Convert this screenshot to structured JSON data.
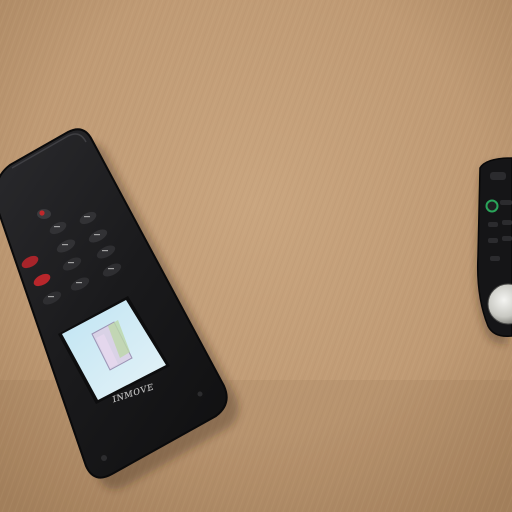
{
  "scene": {
    "surface": "tan-carpet",
    "colors": {
      "carpet": "#c49f7a",
      "carpet_dark": "#a88463",
      "remote_body": "#1c1c1e",
      "remote_edge": "#0c0c0d",
      "screen_glow": "#cfe8f2",
      "button_red": "#c0282b",
      "button_green": "#2aa45a"
    },
    "objects": [
      {
        "name": "handheld-remote",
        "screen_icon": "device-illustration-icon",
        "brand_label": "ɪɴᴍᴏᴠᴇ"
      },
      {
        "name": "secondary-remote",
        "note_icon": "round-silver-button"
      }
    ]
  }
}
